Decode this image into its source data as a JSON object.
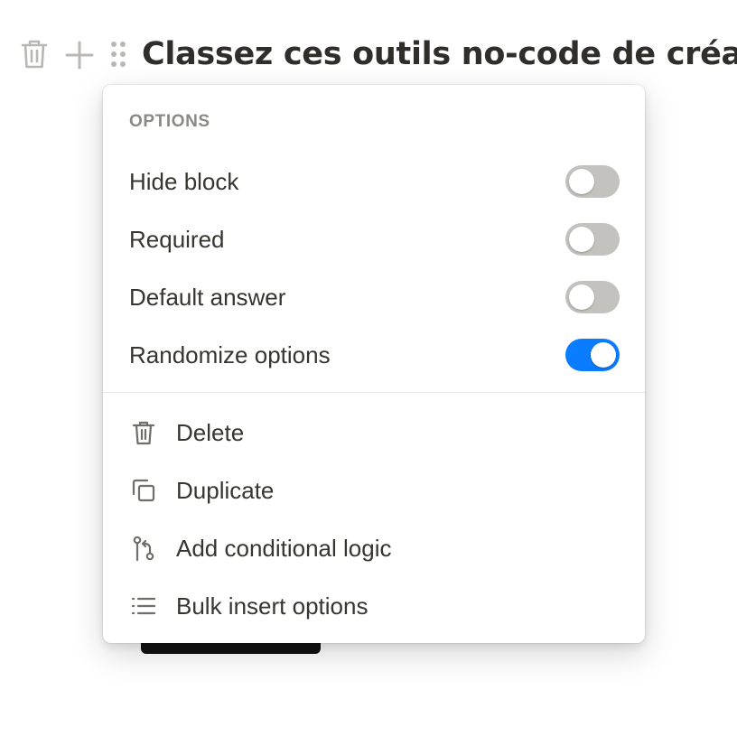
{
  "block": {
    "title": "Classez ces outils no-code de créa",
    "icons": {
      "delete": "trash-icon",
      "add": "plus-icon",
      "drag": "drag-handle-icon"
    }
  },
  "menu": {
    "section_label": "OPTIONS",
    "options": [
      {
        "label": "Hide block",
        "enabled": false
      },
      {
        "label": "Required",
        "enabled": false
      },
      {
        "label": "Default answer",
        "enabled": false
      },
      {
        "label": "Randomize options",
        "enabled": true
      }
    ],
    "actions": [
      {
        "label": "Delete",
        "icon": "trash-icon"
      },
      {
        "label": "Duplicate",
        "icon": "duplicate-icon"
      },
      {
        "label": "Add conditional logic",
        "icon": "branch-icon"
      },
      {
        "label": "Bulk insert options",
        "icon": "list-icon"
      }
    ]
  },
  "colors": {
    "toggle_on": "#0a7cff",
    "toggle_off": "#c3c2bf",
    "text": "#37352f",
    "muted": "#8a8985"
  }
}
